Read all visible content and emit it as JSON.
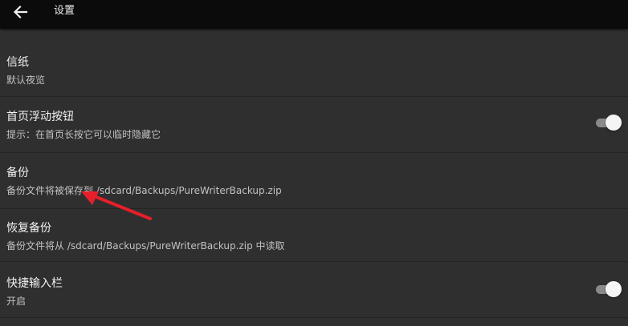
{
  "toolbar": {
    "title": "设置",
    "back_icon": "arrow-left-icon"
  },
  "settings": {
    "items": [
      {
        "title": "信纸",
        "subtitle": "默认夜览"
      },
      {
        "title": "首页浮动按钮",
        "subtitle": "提示：在首页长按它可以临时隐藏它",
        "toggle_on": true
      },
      {
        "title": "备份",
        "subtitle": "备份文件将被保存到 /sdcard/Backups/PureWriterBackup.zip"
      },
      {
        "title": "恢复备份",
        "subtitle": "备份文件将从 /sdcard/Backups/PureWriterBackup.zip 中读取"
      },
      {
        "title": "快捷输入栏",
        "subtitle": "开启",
        "toggle_on": true
      }
    ]
  },
  "colors": {
    "background": "#2f2f2f",
    "toolbar": "#0b0b0b",
    "annotation_arrow": "#e5202a"
  }
}
